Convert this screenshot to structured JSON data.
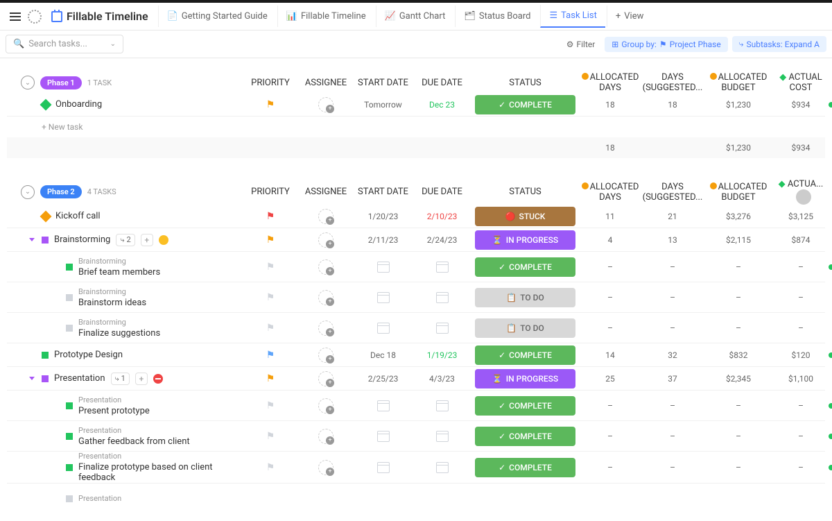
{
  "header": {
    "title": "Fillable Timeline"
  },
  "tabs": {
    "guide": "Getting Started Guide",
    "timeline": "Fillable Timeline",
    "gantt": "Gantt Chart",
    "status": "Status Board",
    "tasklist": "Task List",
    "view": "View"
  },
  "toolbar": {
    "search_placeholder": "Search tasks...",
    "filter": "Filter",
    "groupby": "Group by:",
    "project_phase": "Project Phase",
    "subtasks": "Subtasks: Expand A"
  },
  "columns": {
    "priority": "PRIORITY",
    "assignee": "ASSIGNEE",
    "start": "START DATE",
    "due": "DUE DATE",
    "status": "STATUS",
    "allocated_days": "ALLOCATED DAYS",
    "days_suggested": "DAYS (SUGGESTED...",
    "allocated_budget": "ALLOCATED BUDGET",
    "actual_cost": "ACTUAL COST",
    "actual_short": "ACTUA..."
  },
  "statuses": {
    "complete": "COMPLETE",
    "stuck": "STUCK",
    "in_progress": "IN PROGRESS",
    "todo": "TO DO"
  },
  "phase1": {
    "badge": "Phase 1",
    "count": "1 TASK",
    "new_task": "+ New task",
    "tasks": [
      {
        "name": "Onboarding",
        "start": "Tomorrow",
        "due": "Dec 23",
        "days": "18",
        "sug": "18",
        "budget": "$1,230",
        "cost": "$934"
      }
    ],
    "summary": {
      "days": "18",
      "budget": "$1,230",
      "cost": "$934"
    }
  },
  "phase2": {
    "badge": "Phase 2",
    "count": "4 TASKS",
    "tasks": {
      "kickoff": {
        "name": "Kickoff call",
        "start": "1/20/23",
        "due": "2/10/23",
        "days": "11",
        "sug": "21",
        "budget": "$3,276",
        "cost": "$3,125"
      },
      "brainstorm": {
        "name": "Brainstorming",
        "subcount": "2",
        "start": "2/11/23",
        "due": "2/24/23",
        "days": "4",
        "sug": "13",
        "budget": "$2,115",
        "cost": "$874"
      },
      "brief": {
        "parent": "Brainstorming",
        "name": "Brief team members"
      },
      "ideas": {
        "parent": "Brainstorming",
        "name": "Brainstorm ideas"
      },
      "finalize_sug": {
        "parent": "Brainstorming",
        "name": "Finalize suggestions"
      },
      "prototype": {
        "name": "Prototype Design",
        "start": "Dec 18",
        "due": "1/19/23",
        "days": "14",
        "sug": "32",
        "budget": "$832",
        "cost": "$120"
      },
      "presentation": {
        "name": "Presentation",
        "subcount": "1",
        "start": "2/25/23",
        "due": "4/3/23",
        "days": "25",
        "sug": "37",
        "budget": "$2,345",
        "cost": "$1,100"
      },
      "present_proto": {
        "parent": "Presentation",
        "name": "Present prototype"
      },
      "gather": {
        "parent": "Presentation",
        "name": "Gather feedback from client"
      },
      "finalize_proto": {
        "parent": "Presentation",
        "name": "Finalize prototype based on client feedback"
      },
      "presentation_last": {
        "parent": "Presentation"
      }
    }
  },
  "dash": "–"
}
